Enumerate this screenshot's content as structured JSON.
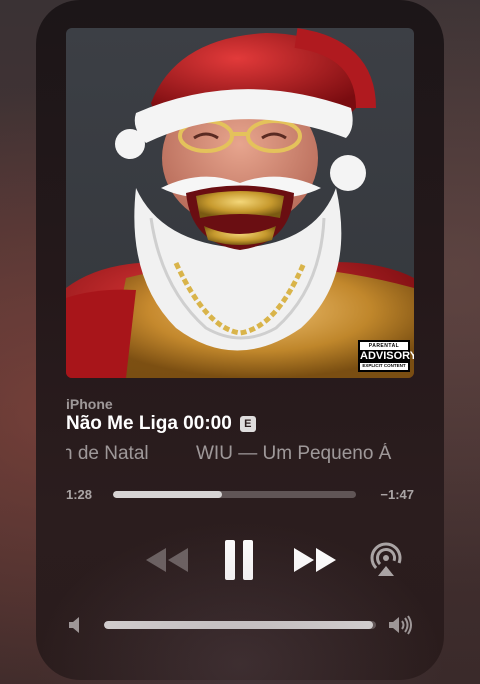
{
  "player": {
    "source": "iPhone",
    "title": "Não Me Liga 00:00",
    "explicit_badge": "E",
    "subtitle_scroll": {
      "segment_1": "n de Natal",
      "segment_2": "WIU — Um Pequeno Á"
    },
    "time_elapsed": "1:28",
    "time_remaining": "−1:47",
    "progress_fraction": 0.45,
    "volume_fraction": 0.99
  },
  "artwork": {
    "advisory_line1": "PARENTAL",
    "advisory_line2": "ADVISORY",
    "advisory_line3": "EXPLICIT CONTENT"
  },
  "icons": {
    "rewind": "rewind-icon",
    "pause": "pause-icon",
    "forward": "fast-forward-icon",
    "airplay": "airplay-icon",
    "volume_low": "speaker-low-icon",
    "volume_high": "speaker-high-icon"
  },
  "colors": {
    "panel": "#24181a",
    "text_primary": "#ffffff",
    "text_secondary": "rgba(255,255,255,0.55)"
  }
}
